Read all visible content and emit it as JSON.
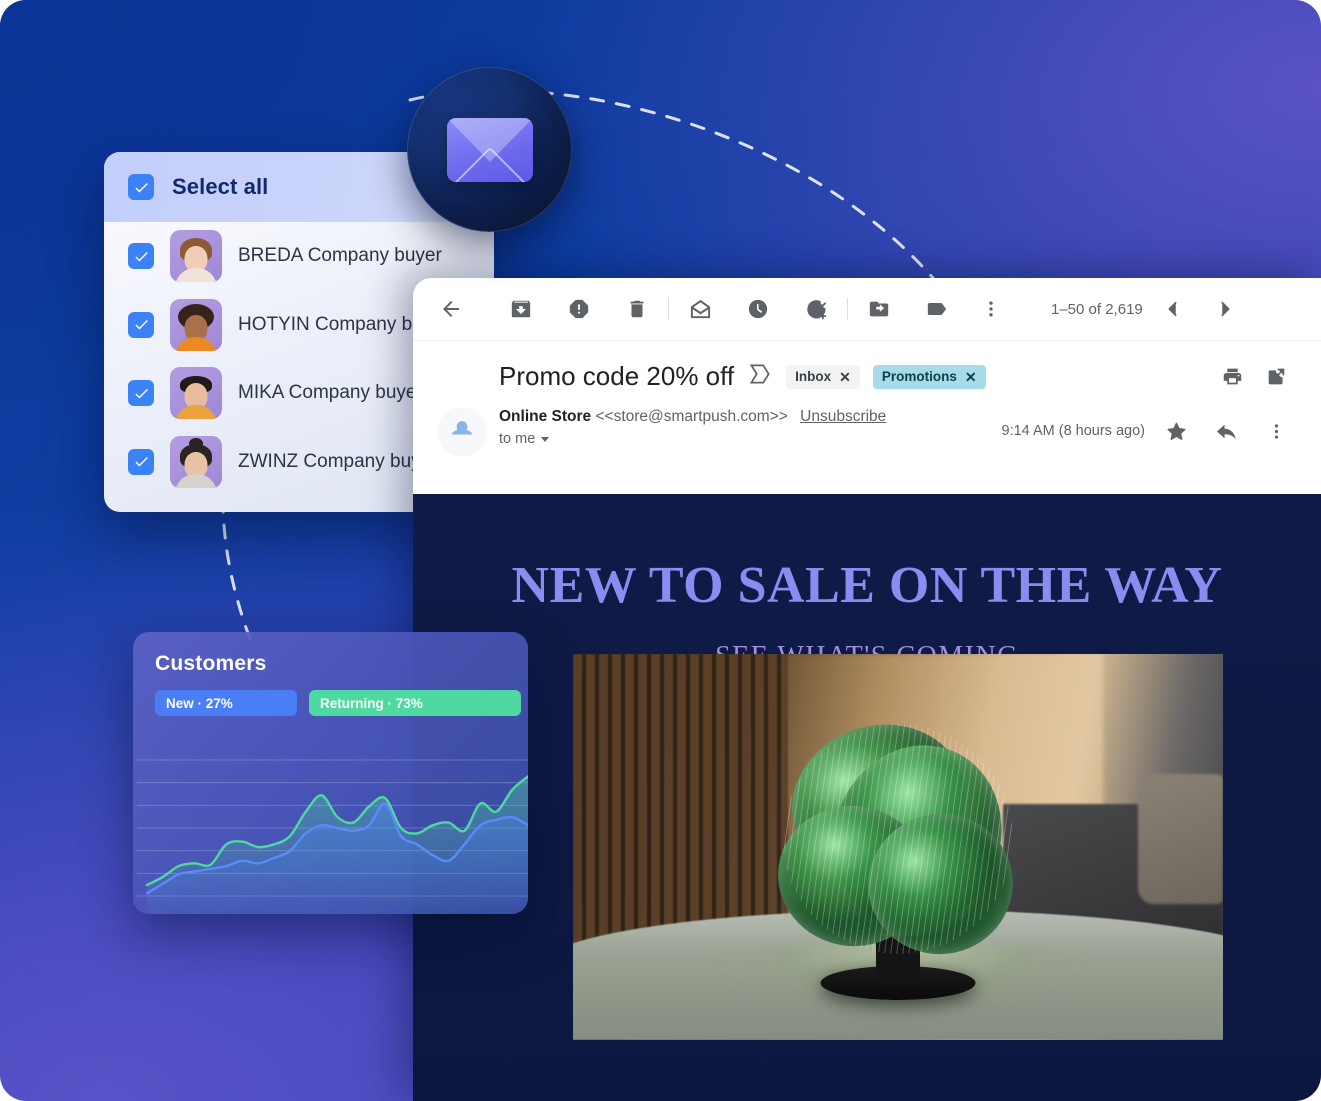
{
  "contacts_panel": {
    "select_all_label": "Select all",
    "select_all_checked": true,
    "rows": [
      {
        "name": "BREDA Company buyer",
        "checked": true,
        "avatar": "woman-brown-hair-avatar"
      },
      {
        "name": "HOTYIN Company buyer",
        "checked": true,
        "avatar": "woman-curly-hair-avatar"
      },
      {
        "name": "MIKA Company buyer",
        "checked": true,
        "avatar": "man-striped-shirt-avatar"
      },
      {
        "name": "ZWINZ Company buyer",
        "checked": true,
        "avatar": "woman-bun-hair-avatar"
      }
    ]
  },
  "envelope_badge": {
    "icon": "envelope-icon"
  },
  "gmail": {
    "toolbar": {
      "back": "back-arrow-icon",
      "archive": "archive-icon",
      "report_spam": "report-spam-icon",
      "delete": "delete-trash-icon",
      "mark_unread": "mark-as-unread-icon",
      "snooze": "snooze-clock-icon",
      "add_to_tasks": "add-to-tasks-icon",
      "move_to": "move-to-folder-icon",
      "labels": "label-tag-icon",
      "more": "more-vertical-icon",
      "page_count": "1–50 of 2,619",
      "prev": "chevron-left-icon",
      "next": "chevron-right-icon"
    },
    "subject": {
      "text": "Promo code 20% off",
      "inbox_chevron_icon": "inbox-chevron-icon",
      "chips": [
        {
          "label": "Inbox",
          "close": "✕",
          "style": "gray"
        },
        {
          "label": "Promotions",
          "close": "✕",
          "style": "teal"
        }
      ],
      "print_icon": "print-icon",
      "open_in_new_icon": "open-in-new-window-icon"
    },
    "sender": {
      "avatar_icon": "sender-avatar-icon",
      "name": "Online Store",
      "email": "<<store@smartpush.com>>",
      "unsubscribe_label": "Unsubscribe",
      "recipient": "to me",
      "timestamp": "9:14 AM (8 hours ago)",
      "star_icon": "star-icon",
      "reply_icon": "reply-arrow-icon",
      "more_icon": "more-vertical-icon"
    },
    "email_body": {
      "title": "NEW TO SALE ON THE WAY",
      "subtitle": "SEE WHAT'S COMING",
      "title_color": "#8b8bf0",
      "subtitle_color": "#a48ce0",
      "product_image_alt": "green-glass-sculptural-table-lamp"
    }
  },
  "customers_card": {
    "title": "Customers",
    "legend": [
      {
        "label": "New · 27%",
        "color": "#4a7ef5"
      },
      {
        "label": "Returning · 73%",
        "color": "#4fd9a0"
      }
    ]
  },
  "chart_data": {
    "type": "area",
    "title": "Customers",
    "xlabel": "",
    "ylabel": "",
    "grid": true,
    "gridlines": 7,
    "legend_position": "top-left",
    "x": [
      0,
      1,
      2,
      3,
      4,
      5,
      6,
      7,
      8,
      9,
      10,
      11,
      12,
      13,
      14,
      15,
      16,
      17,
      18,
      19,
      20,
      21,
      22,
      23,
      24
    ],
    "series": [
      {
        "name": "Returning · 73%",
        "color": "#4fd9a0",
        "values": [
          8,
          14,
          22,
          24,
          23,
          38,
          40,
          36,
          38,
          44,
          62,
          74,
          58,
          54,
          66,
          72,
          50,
          46,
          52,
          54,
          48,
          68,
          62,
          78,
          88
        ]
      },
      {
        "name": "New · 27%",
        "color": "#4a7ef5",
        "values": [
          2,
          9,
          16,
          18,
          20,
          22,
          26,
          24,
          28,
          33,
          46,
          52,
          50,
          48,
          52,
          68,
          44,
          38,
          30,
          26,
          38,
          52,
          56,
          58,
          52
        ]
      }
    ],
    "ylim": [
      0,
      100
    ]
  }
}
